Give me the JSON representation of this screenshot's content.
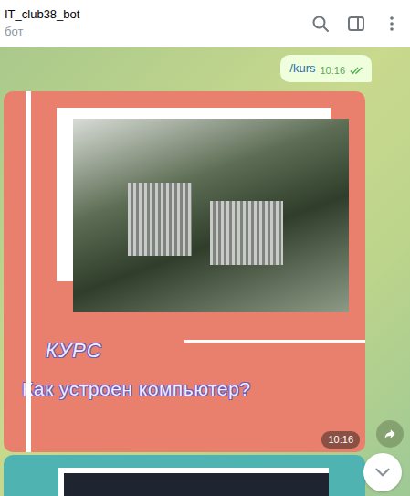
{
  "header": {
    "title": "IT_club38_bot",
    "subtitle": "бот"
  },
  "messages": [
    {
      "kind": "outgoing",
      "text": "/kurs",
      "time": "10:16",
      "read": true
    },
    {
      "kind": "poster",
      "title": "КУРС",
      "subtitle": "Как устроен компьютер?",
      "time": "10:16",
      "color": "#e9806e"
    },
    {
      "kind": "poster-partial",
      "color": "#4fb4b1"
    }
  ]
}
